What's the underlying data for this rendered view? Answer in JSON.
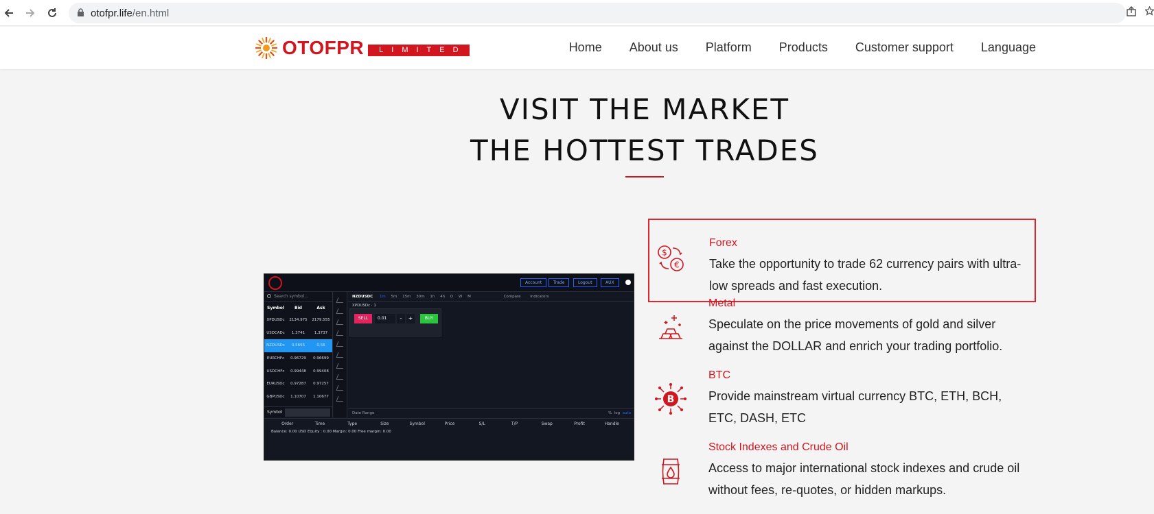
{
  "browser": {
    "url_host": "otofpr.life",
    "url_path": "/en.html"
  },
  "header": {
    "logo_name": "OTOFPR",
    "logo_tag": "LIMITED",
    "nav": [
      "Home",
      "About us",
      "Platform",
      "Products",
      "Customer support",
      "Language"
    ]
  },
  "hero": {
    "line1": "VISIT THE MARKET",
    "line2": "THE HOTTEST TRADES"
  },
  "platform": {
    "top_buttons": [
      "Account",
      "Trade",
      "Logout",
      "AUX"
    ],
    "search_placeholder": "Search symbol...",
    "columns": [
      "Symbol",
      "Bid",
      "Ask"
    ],
    "rows": [
      [
        "XPDUSDc",
        "2134.975",
        "2179.555"
      ],
      [
        "USDCADc",
        "1.3741",
        "1.3737"
      ],
      [
        "NZDUSDc",
        "0.5655",
        "0.56"
      ],
      [
        "EURCHFc",
        "0.96729",
        "0.96699"
      ],
      [
        "USDCHFc",
        "0.99448",
        "0.99408"
      ],
      [
        "EURUSDc",
        "0.97287",
        "0.97257"
      ],
      [
        "GBPUSDc",
        "1.10707",
        "1.10677"
      ]
    ],
    "symbol_label": "Symbol",
    "chart_symbol": "NZDUSDC",
    "timeframes": [
      "1m",
      "5m",
      "15m",
      "30m",
      "1h",
      "4h",
      "D",
      "W",
      "M"
    ],
    "compare": "Compare",
    "indicators": "Indicators",
    "pair_label": "XPDUSDc",
    "pair_value": "1",
    "sell": "SELL",
    "qty": "0.01",
    "minus": "-",
    "plus": "+",
    "buy": "BUY",
    "date_range": "Date Range",
    "scale_pct": "%",
    "scale_log": "log",
    "scale_auto": "auto",
    "order_columns": [
      "Order",
      "Time",
      "Type",
      "Size",
      "Symbol",
      "Price",
      "S/L",
      "T/P",
      "Swap",
      "Profit",
      "Handle"
    ],
    "balance_line": "Balance: 0.00 USD Equity : 0.00 Margin: 0.00 Free margin: 0.00"
  },
  "products": [
    {
      "title": "Forex",
      "desc": "Take the opportunity to trade 62 currency pairs with ultra-low spreads and fast execution.",
      "icon": "currency-exchange-icon"
    },
    {
      "title": "Metal",
      "desc": "Speculate on the price movements of gold and silver against the DOLLAR and enrich your trading portfolio.",
      "icon": "gold-bars-icon"
    },
    {
      "title": "BTC",
      "desc": "Provide mainstream virtual currency BTC, ETH, BCH, ETC, DASH, ETC",
      "icon": "bitcoin-icon"
    },
    {
      "title": "Stock Indexes and Crude Oil",
      "desc": "Access to major international stock indexes and crude oil without fees, re-quotes, or hidden markups.",
      "icon": "oil-barrel-icon"
    }
  ],
  "colors": {
    "brand_red": "#d0161e",
    "highlight_border": "#e0262c"
  }
}
